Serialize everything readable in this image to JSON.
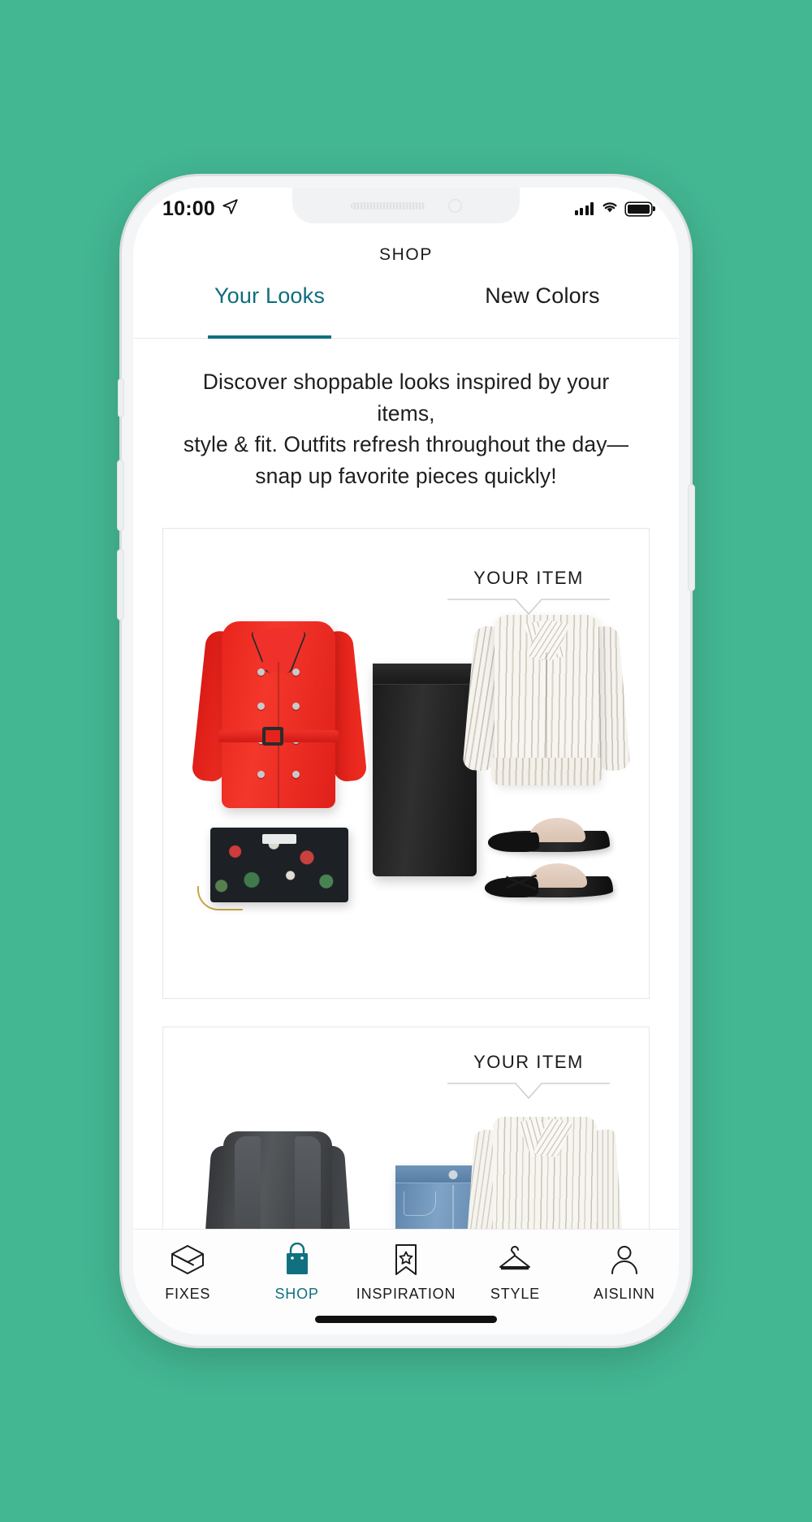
{
  "status_bar": {
    "time": "10:00",
    "location_icon": "location-arrow-icon",
    "signal_icon": "cellular-signal-icon",
    "wifi_icon": "wifi-icon",
    "battery_icon": "battery-full-icon"
  },
  "header": {
    "title": "SHOP"
  },
  "tabs": {
    "active_index": 0,
    "items": [
      {
        "label": "Your Looks",
        "active": true
      },
      {
        "label": "New Colors",
        "active": false
      }
    ],
    "accent_color": "#11707f"
  },
  "blurb": {
    "line1": "Discover shoppable looks inspired by your items,",
    "line2": "style & fit. Outfits refresh throughout the day—",
    "line3": "snap up favorite pieces quickly!"
  },
  "looks": [
    {
      "your_item_label": "YOUR ITEM",
      "items": [
        {
          "name": "red-trench-coat",
          "color": "#ea251d"
        },
        {
          "name": "floral-clutch-bag",
          "color": "#1d2126"
        },
        {
          "name": "black-pencil-skirt",
          "color": "#1b1b1b"
        },
        {
          "name": "striped-peplum-blouse",
          "color": "#f7f5f0"
        },
        {
          "name": "black-pointed-flat-shoe",
          "color": "#141414"
        },
        {
          "name": "black-strappy-flat-shoe",
          "color": "#141414"
        }
      ]
    },
    {
      "your_item_label": "YOUR ITEM",
      "items": [
        {
          "name": "grey-knit-cardigan",
          "color": "#434648"
        },
        {
          "name": "blue-denim-shorts",
          "color": "#6d91b6"
        },
        {
          "name": "striped-button-down-blouse",
          "color": "#f7f5f0"
        }
      ]
    }
  ],
  "tabbar": {
    "active_index": 1,
    "accent_color": "#11707f",
    "items": [
      {
        "label": "FIXES",
        "icon": "box-icon",
        "active": false
      },
      {
        "label": "SHOP",
        "icon": "shopping-bag-icon",
        "active": true
      },
      {
        "label": "INSPIRATION",
        "icon": "bookmark-star-icon",
        "active": false
      },
      {
        "label": "STYLE",
        "icon": "clothes-hanger-icon",
        "active": false
      },
      {
        "label": "AISLINN",
        "icon": "user-avatar-icon",
        "active": false
      }
    ]
  }
}
